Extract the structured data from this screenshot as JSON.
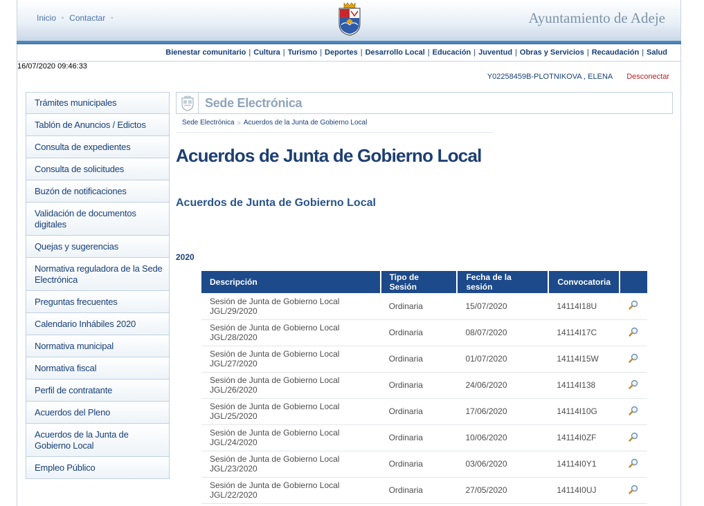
{
  "header": {
    "links": [
      "Inicio",
      "Contactar"
    ],
    "brand": "Ayuntamiento de Adeje"
  },
  "nav": {
    "items": [
      "Bienestar comunitario",
      "Cultura",
      "Turismo",
      "Deportes",
      "Desarrollo Local",
      "Educación",
      "Juventud",
      "Obras y Servicios",
      "Recaudación",
      "Salud"
    ]
  },
  "timestamp": "16/07/2020 09:46:33",
  "user": {
    "name": "Y02258459B-PLOTNIKOVA , ELENA",
    "logout_label": "Desconectar"
  },
  "sidebar": {
    "items": [
      {
        "label": "Trámites municipales"
      },
      {
        "label": "Tablón de Anuncios / Edictos"
      },
      {
        "label": "Consulta de expedientes"
      },
      {
        "label": "Consulta de solicitudes"
      },
      {
        "label": "Buzón de notificaciones"
      },
      {
        "label": "Validación de documentos digitales"
      },
      {
        "label": "Quejas y sugerencias"
      },
      {
        "label": "Normativa reguladora de la Sede Electrónica"
      },
      {
        "label": "Preguntas frecuentes"
      },
      {
        "label": "Calendario Inhábiles 2020"
      },
      {
        "label": "Normativa municipal"
      },
      {
        "label": "Normativa fiscal"
      },
      {
        "label": "Perfil de contratante"
      },
      {
        "label": "Acuerdos del Pleno"
      },
      {
        "label": "Acuerdos de la Junta de Gobierno Local"
      },
      {
        "label": "Empleo Público"
      }
    ]
  },
  "sede": {
    "title": "Sede Electrónica"
  },
  "breadcrumb": {
    "items": [
      "Sede Electrónica",
      "Acuerdos de la Junta de Gobierno Local"
    ]
  },
  "page": {
    "title": "Acuerdos de Junta de Gobierno Local",
    "subtitle": "Acuerdos de Junta de Gobierno Local",
    "year": "2020"
  },
  "table": {
    "headers": [
      "Descripción",
      "Tipo de Sesión",
      "Fecha de la sesión",
      "Convocatoria"
    ],
    "rows": [
      {
        "desc": "Sesión de Junta de Gobierno Local",
        "code": "JGL/29/2020",
        "tipo": "Ordinaria",
        "fecha": "15/07/2020",
        "conv": "14114I18U"
      },
      {
        "desc": "Sesión de Junta de Gobierno Local",
        "code": "JGL/28/2020",
        "tipo": "Ordinaria",
        "fecha": "08/07/2020",
        "conv": "14114I17C"
      },
      {
        "desc": "Sesión de Junta de Gobierno Local",
        "code": "JGL/27/2020",
        "tipo": "Ordinaria",
        "fecha": "01/07/2020",
        "conv": "14114I15W"
      },
      {
        "desc": "Sesión de Junta de Gobierno Local",
        "code": "JGL/26/2020",
        "tipo": "Ordinaria",
        "fecha": "24/06/2020",
        "conv": "14114I138"
      },
      {
        "desc": "Sesión de Junta de Gobierno Local",
        "code": "JGL/25/2020",
        "tipo": "Ordinaria",
        "fecha": "17/06/2020",
        "conv": "14114I10G"
      },
      {
        "desc": "Sesión de Junta de Gobierno Local",
        "code": "JGL/24/2020",
        "tipo": "Ordinaria",
        "fecha": "10/06/2020",
        "conv": "14114I0ZF"
      },
      {
        "desc": "Sesión de Junta de Gobierno Local",
        "code": "JGL/23/2020",
        "tipo": "Ordinaria",
        "fecha": "03/06/2020",
        "conv": "14114I0Y1"
      },
      {
        "desc": "Sesión de Junta de Gobierno Local",
        "code": "JGL/22/2020",
        "tipo": "Ordinaria",
        "fecha": "27/05/2020",
        "conv": "14114I0UJ"
      }
    ],
    "row_action_icon": "magnifier-icon"
  },
  "colors": {
    "table_header_bg": "#1d4a8a",
    "nav_text": "#173f78",
    "logout": "#b42323",
    "header_bar": "#4d87bd"
  }
}
